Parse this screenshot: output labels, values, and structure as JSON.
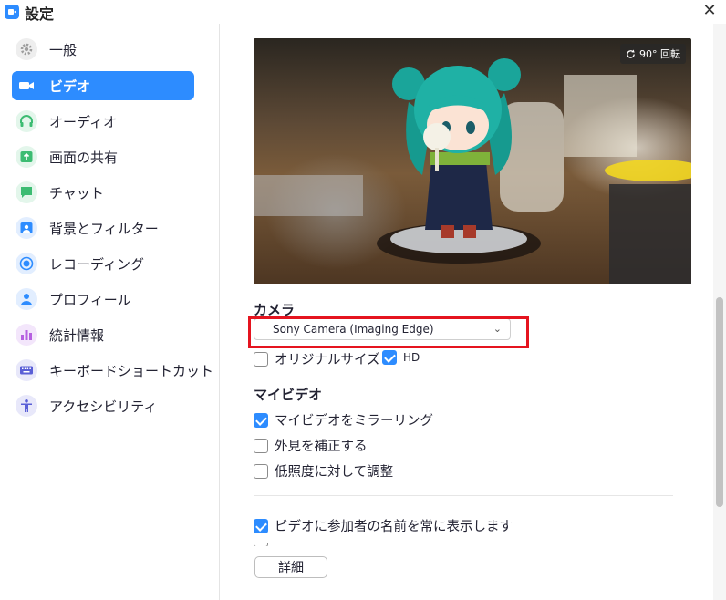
{
  "window": {
    "title": "設定",
    "close_glyph": "✕"
  },
  "sidebar": {
    "items": [
      {
        "label": "一般",
        "icon": "gear-icon",
        "color": "#9e9e9e"
      },
      {
        "label": "ビデオ",
        "icon": "video-camera-icon",
        "color": "#ffffff",
        "active": true
      },
      {
        "label": "オーディオ",
        "icon": "headphones-icon",
        "color": "#3cbc72"
      },
      {
        "label": "画面の共有",
        "icon": "share-screen-icon",
        "color": "#3cbc72"
      },
      {
        "label": "チャット",
        "icon": "chat-icon",
        "color": "#3cbc72"
      },
      {
        "label": "背景とフィルター",
        "icon": "background-filter-icon",
        "color": "#2d8cff"
      },
      {
        "label": "レコーディング",
        "icon": "record-icon",
        "color": "#2d8cff"
      },
      {
        "label": "プロフィール",
        "icon": "profile-icon",
        "color": "#2d8cff"
      },
      {
        "label": "統計情報",
        "icon": "statistics-icon",
        "color": "#b660e0"
      },
      {
        "label": "キーボードショートカット",
        "icon": "keyboard-icon",
        "color": "#5a5fd6"
      },
      {
        "label": "アクセシビリティ",
        "icon": "accessibility-icon",
        "color": "#5a5fd6"
      }
    ]
  },
  "video": {
    "rotate_label": "90° 回転",
    "camera_title": "カメラ",
    "camera_selected": "Sony Camera (Imaging Edge)",
    "original_size_label": "オリジナルサイズ",
    "original_size_checked": false,
    "hd_label": "HD",
    "hd_checked": true,
    "my_video_title": "マイビデオ",
    "mirror_label": "マイビデオをミラーリング",
    "mirror_checked": true,
    "touch_up_label": "外見を補正する",
    "touch_up_checked": false,
    "low_light_label": "低照度に対して調整",
    "low_light_checked": false,
    "show_names_label": "ビデオに参加者の名前を常に表示します",
    "show_names_checked": true,
    "details_button": "詳細"
  },
  "colors": {
    "accent": "#2d8cff",
    "highlight": "#e5141f"
  }
}
